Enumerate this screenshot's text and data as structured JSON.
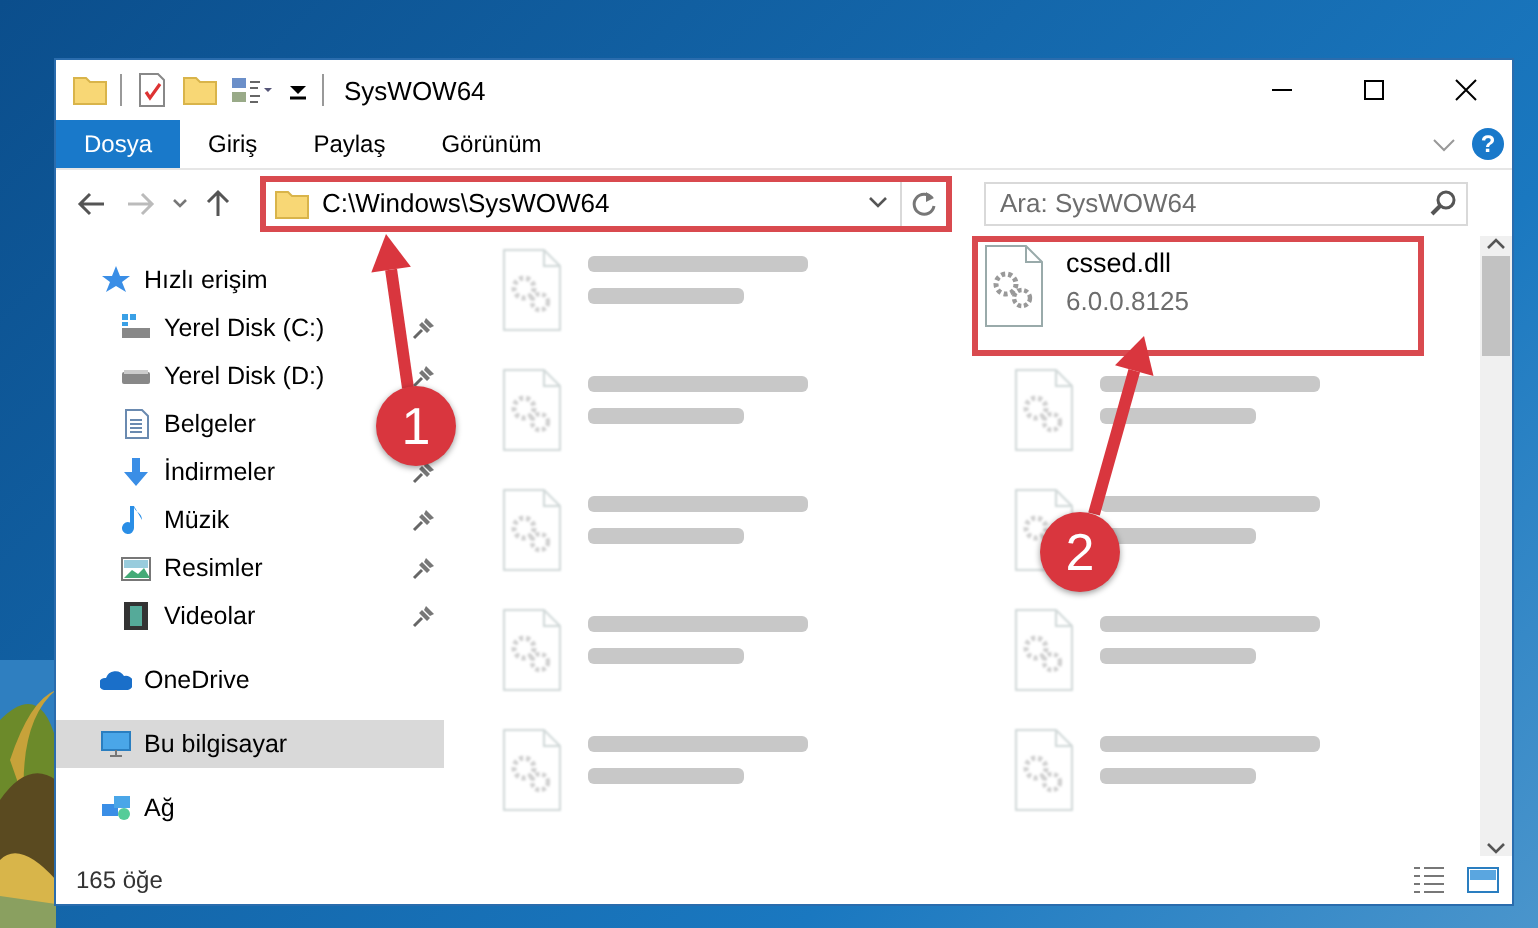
{
  "window": {
    "title": "SysWOW64"
  },
  "ribbon_tabs": [
    {
      "label": "Dosya",
      "selected": true
    },
    {
      "label": "Giriş",
      "selected": false
    },
    {
      "label": "Paylaş",
      "selected": false
    },
    {
      "label": "Görünüm",
      "selected": false
    }
  ],
  "help_button": "?",
  "address": {
    "path": "C:\\Windows\\SysWOW64",
    "highlighted": true
  },
  "search": {
    "placeholder": "Ara: SysWOW64"
  },
  "nav": [
    {
      "label": "Hızlı erişim",
      "kind": "star",
      "selected": false,
      "children": [
        {
          "label": "Yerel Disk (C:)",
          "kind": "drive-c",
          "pinned": true,
          "selected": false
        },
        {
          "label": "Yerel Disk (D:)",
          "kind": "drive",
          "pinned": true,
          "selected": false
        },
        {
          "label": "Belgeler",
          "kind": "docs",
          "pinned": false,
          "selected": false
        },
        {
          "label": "İndirmeler",
          "kind": "download",
          "pinned": true,
          "selected": false
        },
        {
          "label": "Müzik",
          "kind": "music",
          "pinned": true,
          "selected": false
        },
        {
          "label": "Resimler",
          "kind": "pictures",
          "pinned": true,
          "selected": false
        },
        {
          "label": "Videolar",
          "kind": "videos",
          "pinned": true,
          "selected": false
        }
      ]
    },
    {
      "label": "OneDrive",
      "kind": "cloud",
      "selected": false
    },
    {
      "label": "Bu bilgisayar",
      "kind": "pc",
      "selected": true
    },
    {
      "label": "Ağ",
      "kind": "network",
      "selected": false
    }
  ],
  "files": [
    {
      "kind": "blurred"
    },
    {
      "kind": "file",
      "name": "cssed.dll",
      "detail": "6.0.0.8125",
      "highlighted": true
    },
    {
      "kind": "blurred"
    },
    {
      "kind": "blurred"
    },
    {
      "kind": "blurred"
    },
    {
      "kind": "blurred"
    },
    {
      "kind": "blurred"
    },
    {
      "kind": "blurred"
    },
    {
      "kind": "blurred"
    },
    {
      "kind": "blurred"
    }
  ],
  "status_bar": {
    "count": "165 öğe"
  },
  "callouts": [
    {
      "number": "1"
    },
    {
      "number": "2"
    }
  ]
}
